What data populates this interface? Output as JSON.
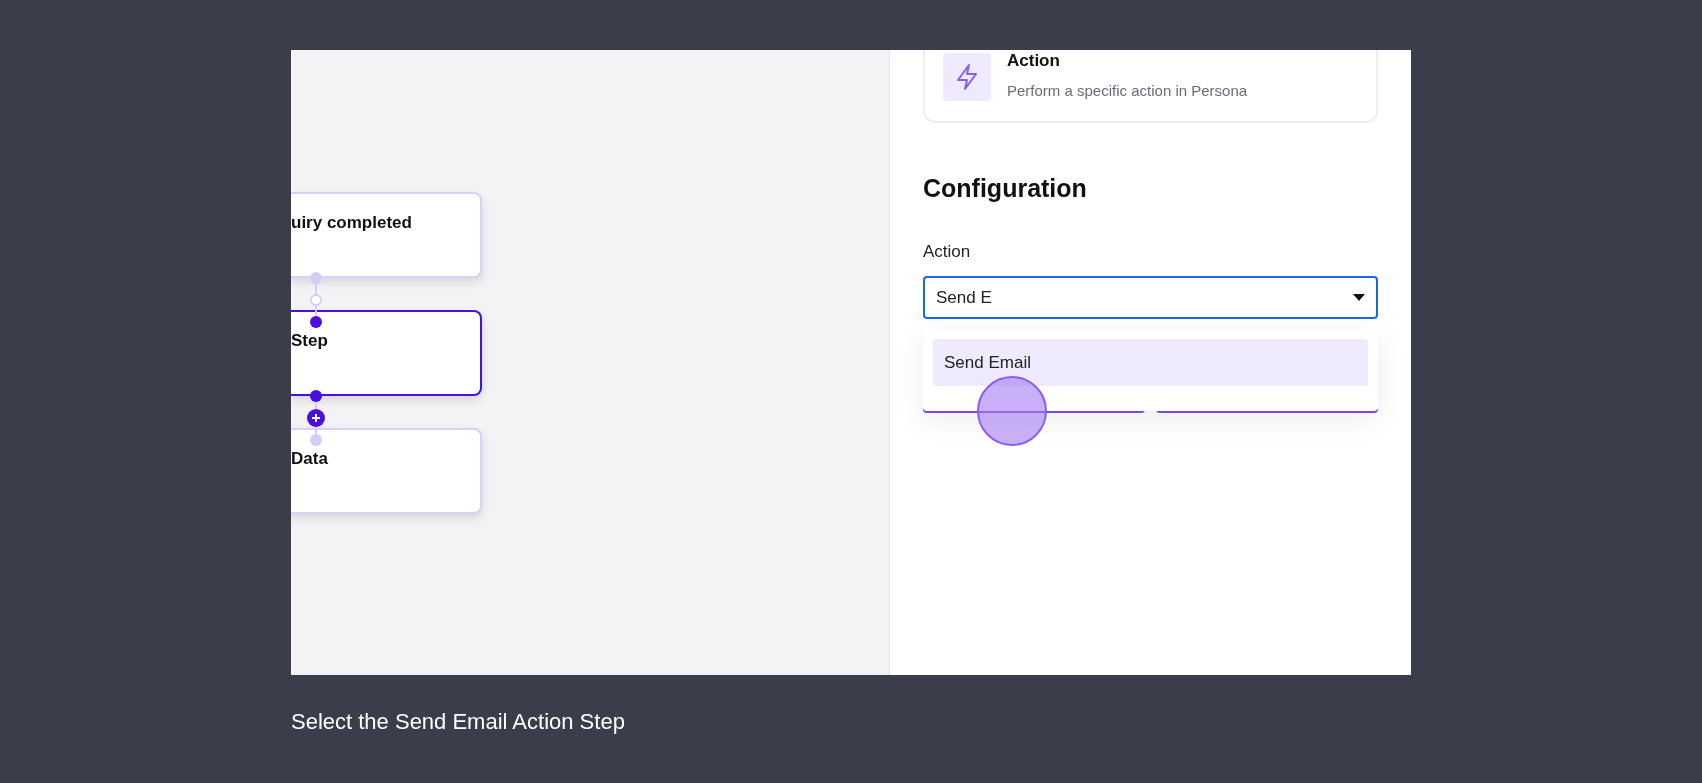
{
  "canvas": {
    "nodes": [
      {
        "title": "uiry completed",
        "selected": false
      },
      {
        "title": "Step",
        "selected": true
      },
      {
        "title": "Data",
        "selected": false
      }
    ]
  },
  "panel": {
    "step_type": {
      "title": "Action",
      "description": "Perform a specific action in Persona"
    },
    "section_title": "Configuration",
    "field": {
      "label": "Action",
      "value": "Send E"
    },
    "dropdown": {
      "options": [
        {
          "label": "Send Email",
          "selected": true
        }
      ]
    }
  },
  "caption": "Select the Send Email Action Step"
}
